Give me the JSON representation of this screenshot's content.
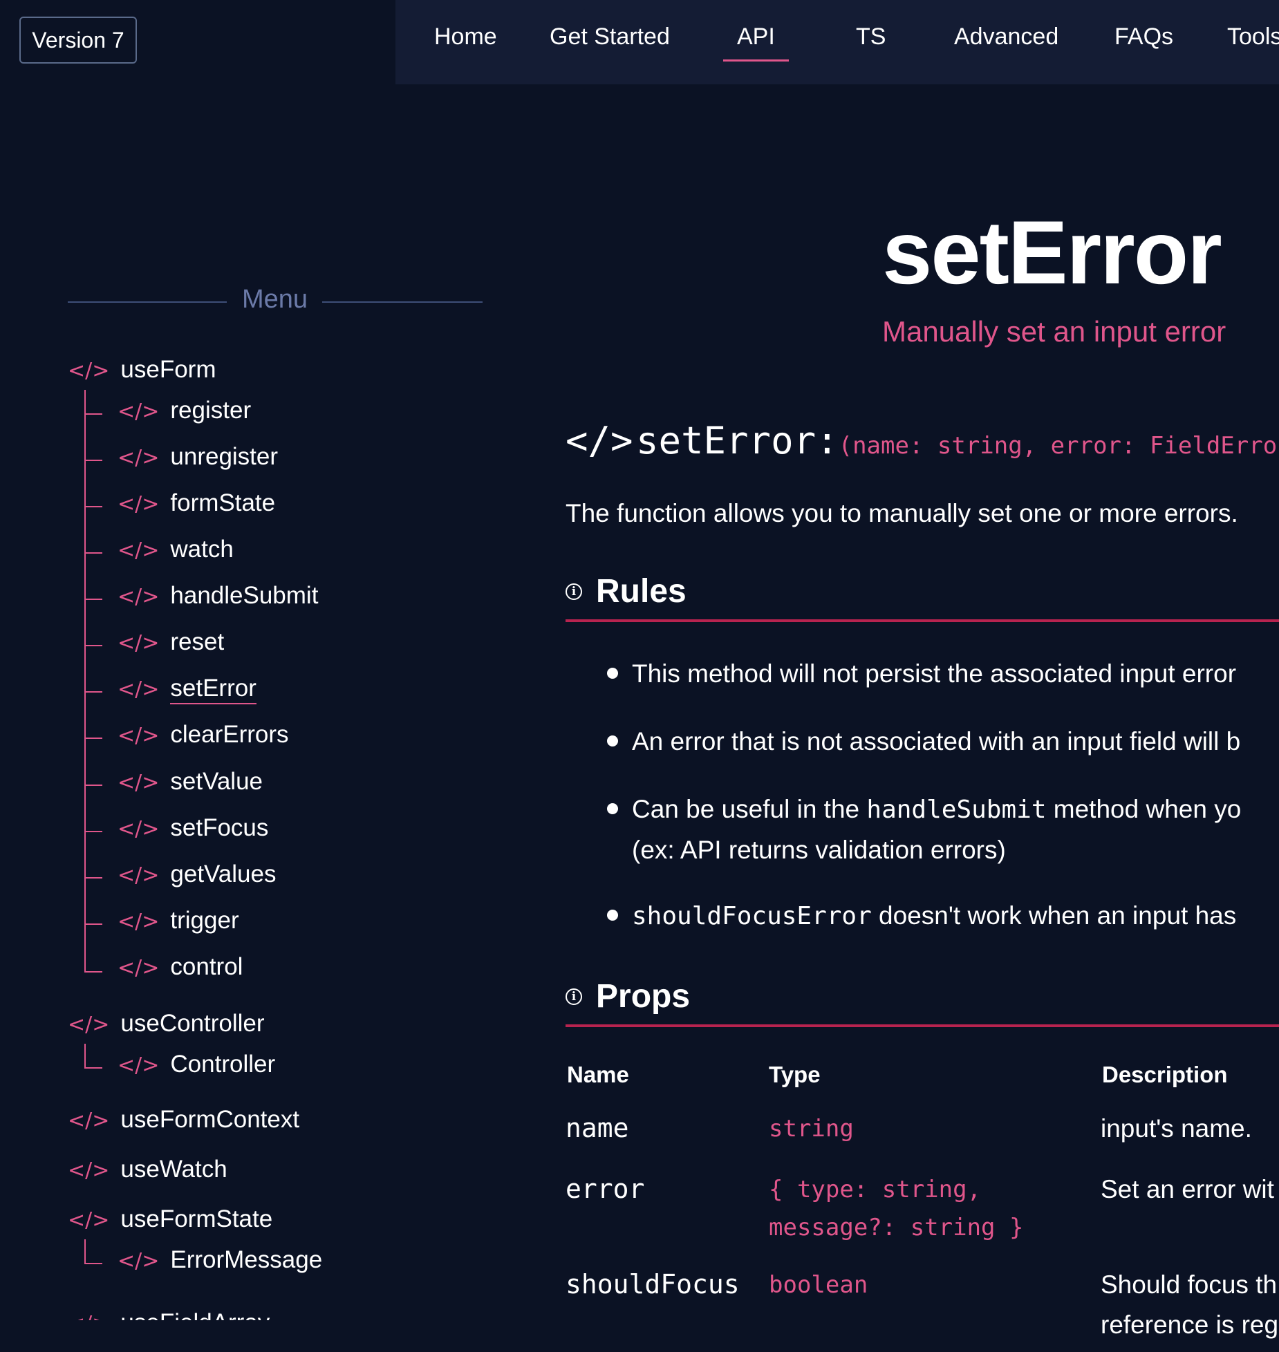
{
  "version_button": {
    "label": "Version 7"
  },
  "nav": {
    "items": [
      "Home",
      "Get Started",
      "API",
      "TS",
      "Advanced",
      "FAQs",
      "Tools"
    ],
    "active": "API"
  },
  "sidebar": {
    "menu_title": "Menu",
    "tag": "</>",
    "groups": [
      {
        "label": "useForm",
        "children": [
          "register",
          "unregister",
          "formState",
          "watch",
          "handleSubmit",
          "reset",
          "setError",
          "clearErrors",
          "setValue",
          "setFocus",
          "getValues",
          "trigger",
          "control"
        ]
      },
      {
        "label": "useController",
        "children": [
          "Controller"
        ]
      },
      {
        "label": "useFormContext",
        "children": []
      },
      {
        "label": "useWatch",
        "children": []
      },
      {
        "label": "useFormState",
        "children": [
          "ErrorMessage"
        ]
      },
      {
        "label": "useFieldArray",
        "children": []
      }
    ],
    "current": "setError"
  },
  "main": {
    "title": "setError",
    "subtitle": "Manually set an input error",
    "signature": {
      "tag": "</>",
      "name": "setError:",
      "params": "(name: string, error: FieldError"
    },
    "description": "The function allows you to manually set one or more errors.",
    "rules": {
      "heading": "Rules",
      "items": [
        {
          "line1": "This method will not persist the associated input error"
        },
        {
          "line1": "An error that is not associated with an input field will b"
        },
        {
          "line1_pre": "Can be useful in the ",
          "line1_code": "handleSubmit",
          "line1_post": " method when yo",
          "line2": "(ex: API returns validation errors)"
        },
        {
          "line1_code": "shouldFocusError",
          "line1_post": " doesn't work when an input has"
        }
      ]
    },
    "props": {
      "heading": "Props",
      "columns": [
        "Name",
        "Type",
        "Description"
      ],
      "rows": [
        {
          "name": "name",
          "type": [
            "string"
          ],
          "desc": [
            "input's name."
          ]
        },
        {
          "name": "error",
          "type": [
            "{ type: string,",
            "message?: string }"
          ],
          "desc": [
            "Set an error wit"
          ]
        },
        {
          "name": "shouldFocus",
          "type": [
            "boolean"
          ],
          "desc": [
            "Should focus th",
            "reference is reg"
          ]
        }
      ]
    }
  }
}
